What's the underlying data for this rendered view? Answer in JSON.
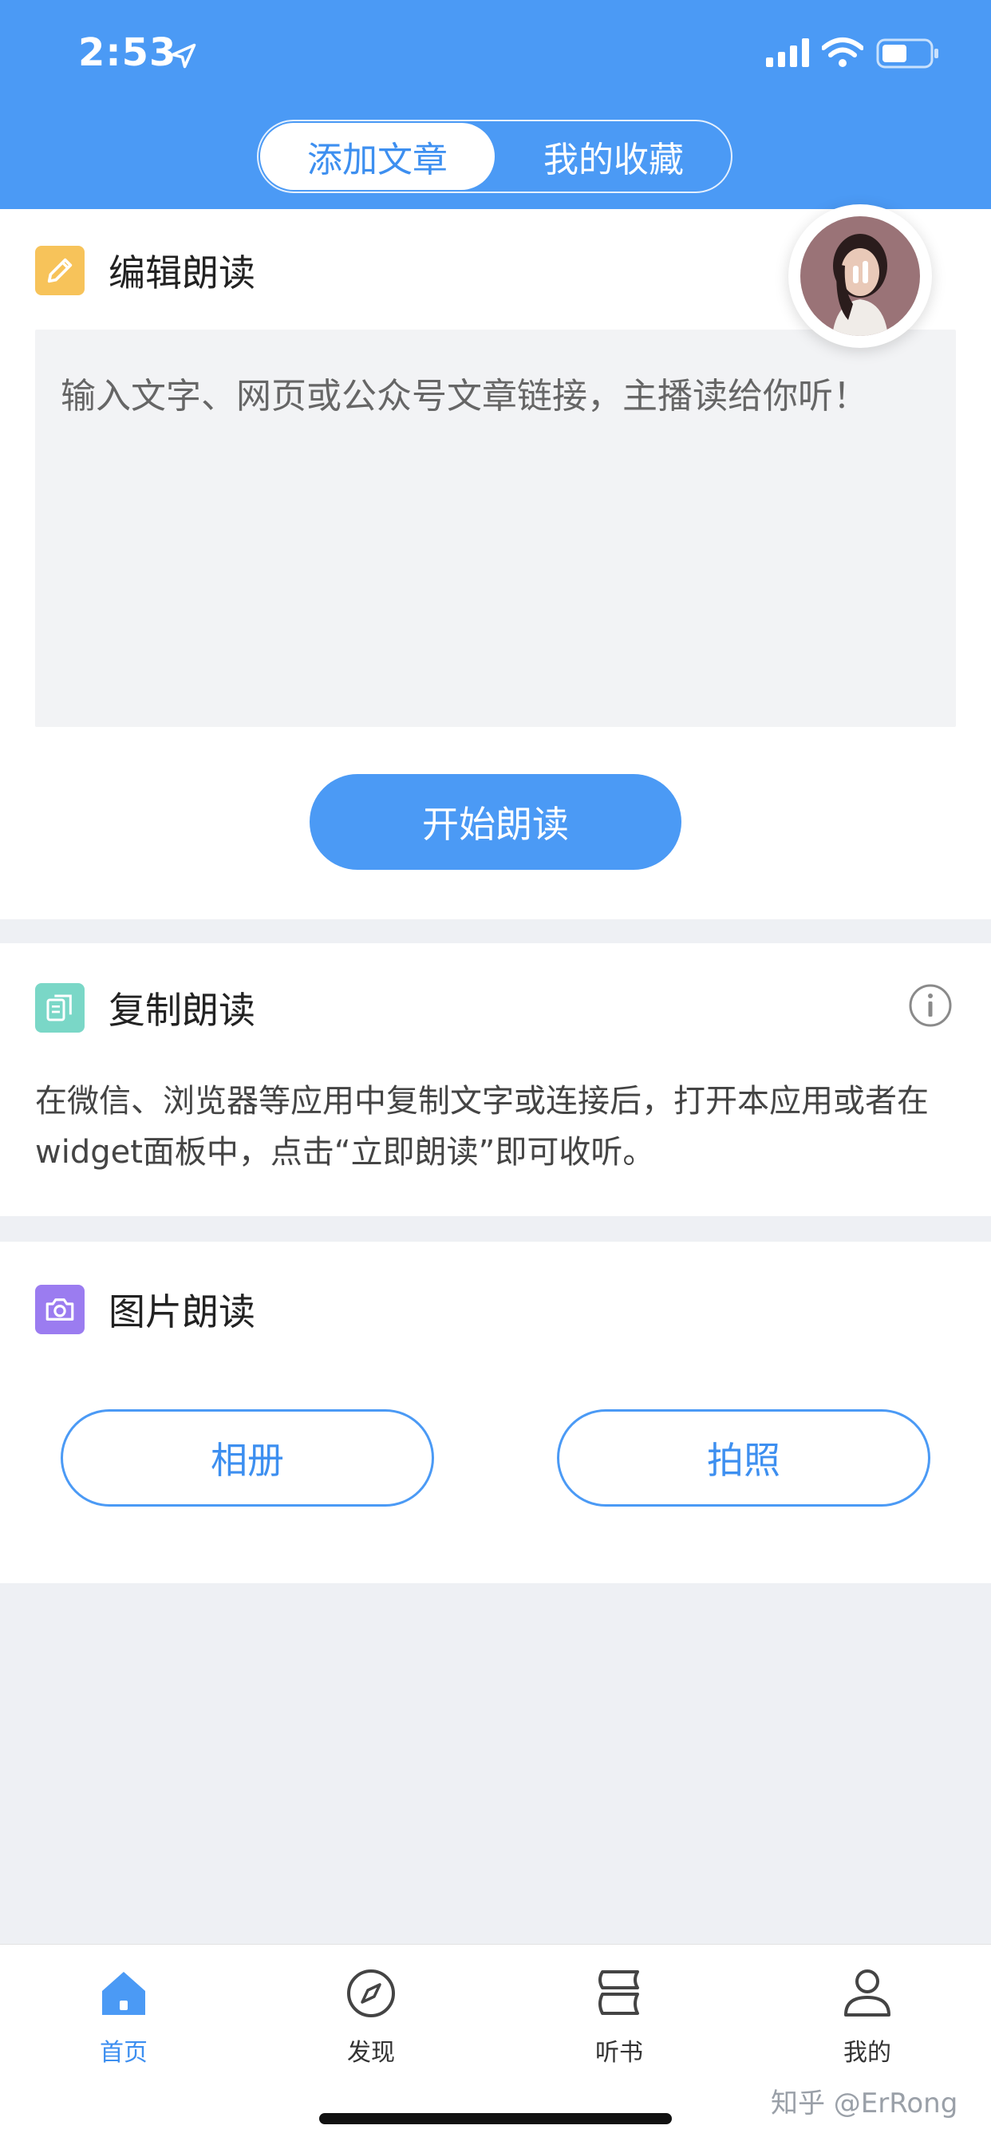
{
  "status": {
    "time": "2:53"
  },
  "segment": {
    "tabs": [
      {
        "label": "添加文章"
      },
      {
        "label": "我的收藏"
      }
    ],
    "active": 0
  },
  "edit": {
    "title": "编辑朗读",
    "placeholder": "输入文字、网页或公众号文章链接，主播读给你听！",
    "start_button": "开始朗读"
  },
  "copy": {
    "title": "复制朗读",
    "description": "在微信、浏览器等应用中复制文字或连接后，打开本应用或者在widget面板中，点击“立即朗读”即可收听。"
  },
  "image": {
    "title": "图片朗读",
    "album_button": "相册",
    "camera_button": "拍照"
  },
  "tabbar": {
    "items": [
      {
        "label": "首页",
        "icon": "home-icon"
      },
      {
        "label": "发现",
        "icon": "compass-icon"
      },
      {
        "label": "听书",
        "icon": "book-icon"
      },
      {
        "label": "我的",
        "icon": "profile-icon"
      }
    ],
    "active": 0
  },
  "watermark": "知乎 @ErRong",
  "colors": {
    "primary": "#4b9af5",
    "edit_icon": "#f7c35a",
    "copy_icon": "#7ad7c7",
    "image_icon": "#9b7cf0"
  }
}
